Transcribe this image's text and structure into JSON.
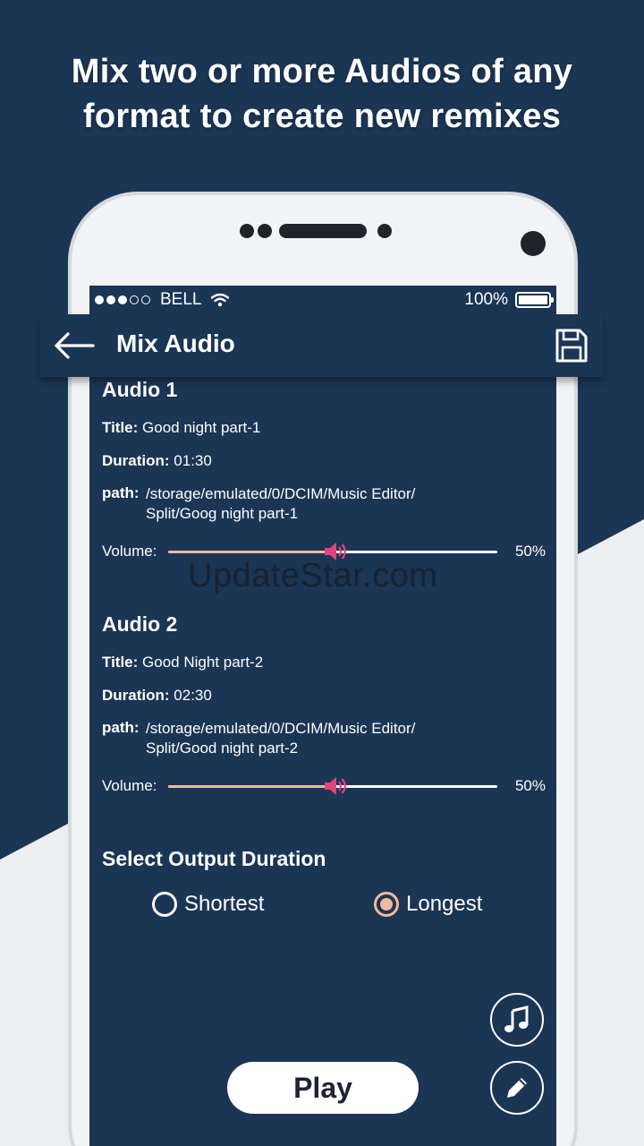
{
  "headline": {
    "line1": "Mix two or more Audios of any",
    "line2": "format to create new remixes"
  },
  "status_bar": {
    "carrier": "BELL",
    "battery": "100%"
  },
  "app_bar": {
    "title": "Mix Audio"
  },
  "audios": [
    {
      "heading": "Audio 1",
      "title_label": "Title:",
      "title": "Good night part-1",
      "duration_label": "Duration:",
      "duration": "01:30",
      "path_label": "path:",
      "path_line1": "/storage/emulated/0/DCIM/Music Editor/",
      "path_line2": "Split/Goog night part-1",
      "volume_label": "Volume:",
      "volume": "50%",
      "volume_fraction": 0.5
    },
    {
      "heading": "Audio 2",
      "title_label": "Title:",
      "title": "Good Night part-2",
      "duration_label": "Duration:",
      "duration": "02:30",
      "path_label": "path:",
      "path_line1": "/storage/emulated/0/DCIM/Music Editor/",
      "path_line2": "Split/Good night part-2",
      "volume_label": "Volume:",
      "volume": "50%",
      "volume_fraction": 0.5
    }
  ],
  "output": {
    "heading": "Select Output Duration",
    "options": [
      "Shortest",
      "Longest"
    ],
    "selected": "Longest"
  },
  "play_label": "Play",
  "watermark": "UpdateStar.com",
  "colors": {
    "navy": "#1b3554",
    "accent": "#f0b99d",
    "speaker_pink": "#e0467a",
    "light_bg": "#eceef1"
  },
  "icons": {
    "back": "arrow-left-icon",
    "save": "floppy-disk-icon",
    "music": "music-note-icon",
    "edit": "pencil-icon",
    "volume_knob": "speaker-icon",
    "wifi": "wifi-icon",
    "battery": "battery-icon"
  }
}
